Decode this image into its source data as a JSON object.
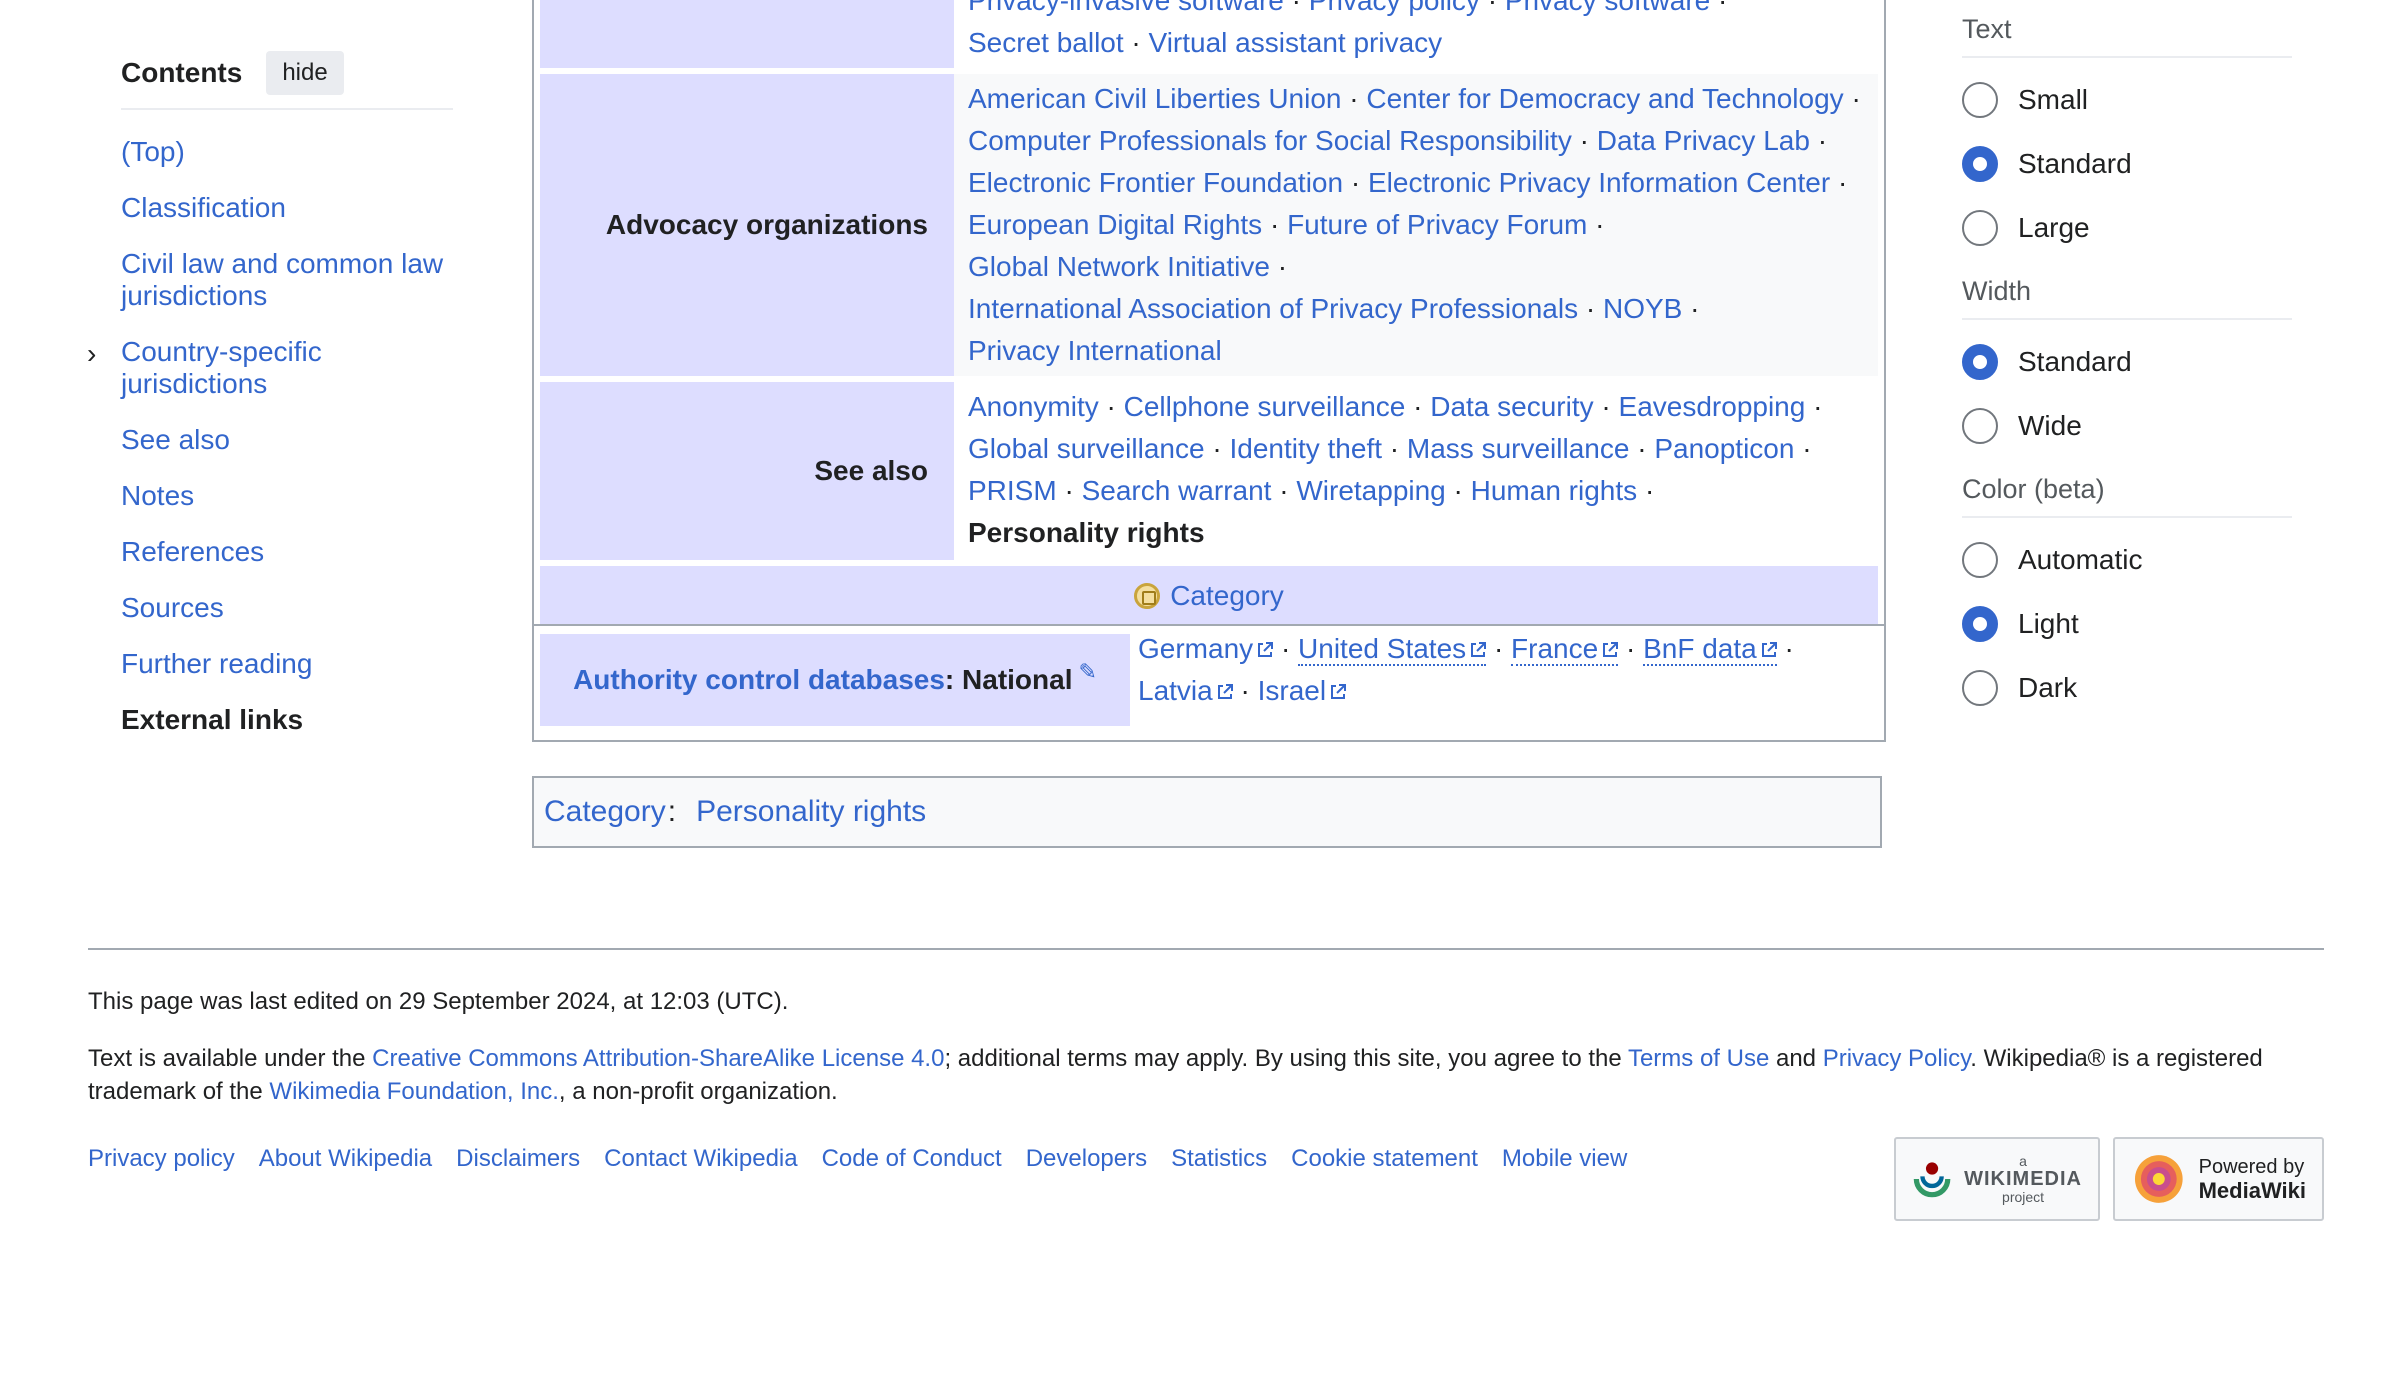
{
  "toc": {
    "title": "Contents",
    "hide_label": "hide",
    "items": [
      {
        "label": "(Top)"
      },
      {
        "label": "Classification"
      },
      {
        "label": "Civil law and common law jurisdictions"
      },
      {
        "label": "Country-specific jurisdictions",
        "expandable": true
      },
      {
        "label": "See also"
      },
      {
        "label": "Notes"
      },
      {
        "label": "References"
      },
      {
        "label": "Sources"
      },
      {
        "label": "Further reading"
      },
      {
        "label": "External links",
        "current": true
      }
    ]
  },
  "navbox": {
    "top_partial": {
      "line1": [
        "Privacy-invasive software",
        "Privacy policy",
        "Privacy software"
      ],
      "line2": [
        "Secret ballot",
        "Virtual assistant privacy"
      ]
    },
    "advocacy": {
      "group": "Advocacy organizations",
      "lines": [
        [
          "American Civil Liberties Union",
          "Center for Democracy and Technology"
        ],
        [
          "Computer Professionals for Social Responsibility",
          "Data Privacy Lab"
        ],
        [
          "Electronic Frontier Foundation",
          "Electronic Privacy Information Center"
        ],
        [
          "European Digital Rights",
          "Future of Privacy Forum"
        ],
        [
          "Global Network Initiative"
        ],
        [
          "International Association of Privacy Professionals",
          "NOYB"
        ],
        [
          "Privacy International"
        ]
      ]
    },
    "see_also": {
      "group": "See also",
      "lines": [
        [
          "Anonymity",
          "Cellphone surveillance",
          "Data security",
          "Eavesdropping"
        ],
        [
          "Global surveillance",
          "Identity theft",
          "Mass surveillance",
          "Panopticon"
        ],
        [
          "PRISM",
          "Search warrant",
          "Wiretapping",
          "Human rights"
        ]
      ],
      "current": "Personality rights"
    },
    "below": {
      "category_label": "Category"
    },
    "authority": {
      "link_label": "Authority control databases",
      "suffix": ": National",
      "line1": [
        "Germany",
        "United States",
        "France",
        "BnF data"
      ],
      "line2": [
        "Latvia",
        "Israel"
      ]
    },
    "separator": "·"
  },
  "catlinks": {
    "label": "Category",
    "colon": ":",
    "item": "Personality rights"
  },
  "appearance": {
    "text": {
      "heading": "Text",
      "options": [
        {
          "label": "Small",
          "checked": false
        },
        {
          "label": "Standard",
          "checked": true
        },
        {
          "label": "Large",
          "checked": false
        }
      ]
    },
    "width": {
      "heading": "Width",
      "options": [
        {
          "label": "Standard",
          "checked": true
        },
        {
          "label": "Wide",
          "checked": false
        }
      ]
    },
    "color": {
      "heading": "Color (beta)",
      "options": [
        {
          "label": "Automatic",
          "checked": false
        },
        {
          "label": "Light",
          "checked": true
        },
        {
          "label": "Dark",
          "checked": false
        }
      ]
    }
  },
  "footer": {
    "last_edited": "This page was last edited on 29 September 2024, at 12:03 (UTC).",
    "license_pre": "Text is available under the ",
    "license_link": "Creative Commons Attribution-ShareAlike License 4.0",
    "license_mid": "; additional terms may apply. By using this site, you agree to the ",
    "terms_link": "Terms of Use",
    "and": " and ",
    "privacy_link": "Privacy Policy",
    "license_post": ". Wikipedia® is a registered trademark of the ",
    "wmf_link": "Wikimedia Foundation, Inc.",
    "license_end": ", a non-profit organization.",
    "places": [
      "Privacy policy",
      "About Wikipedia",
      "Disclaimers",
      "Contact Wikipedia",
      "Code of Conduct",
      "Developers",
      "Statistics",
      "Cookie statement",
      "Mobile view"
    ],
    "badge_wikimedia": {
      "small": "a",
      "big": "WIKIMEDIA",
      "sub": "project"
    },
    "badge_mediawiki": {
      "small": "Powered by",
      "big": "MediaWiki"
    }
  },
  "colors": {
    "link": "#3366cc",
    "group_bg": "#ddddff",
    "border": "#a2a9b1"
  }
}
